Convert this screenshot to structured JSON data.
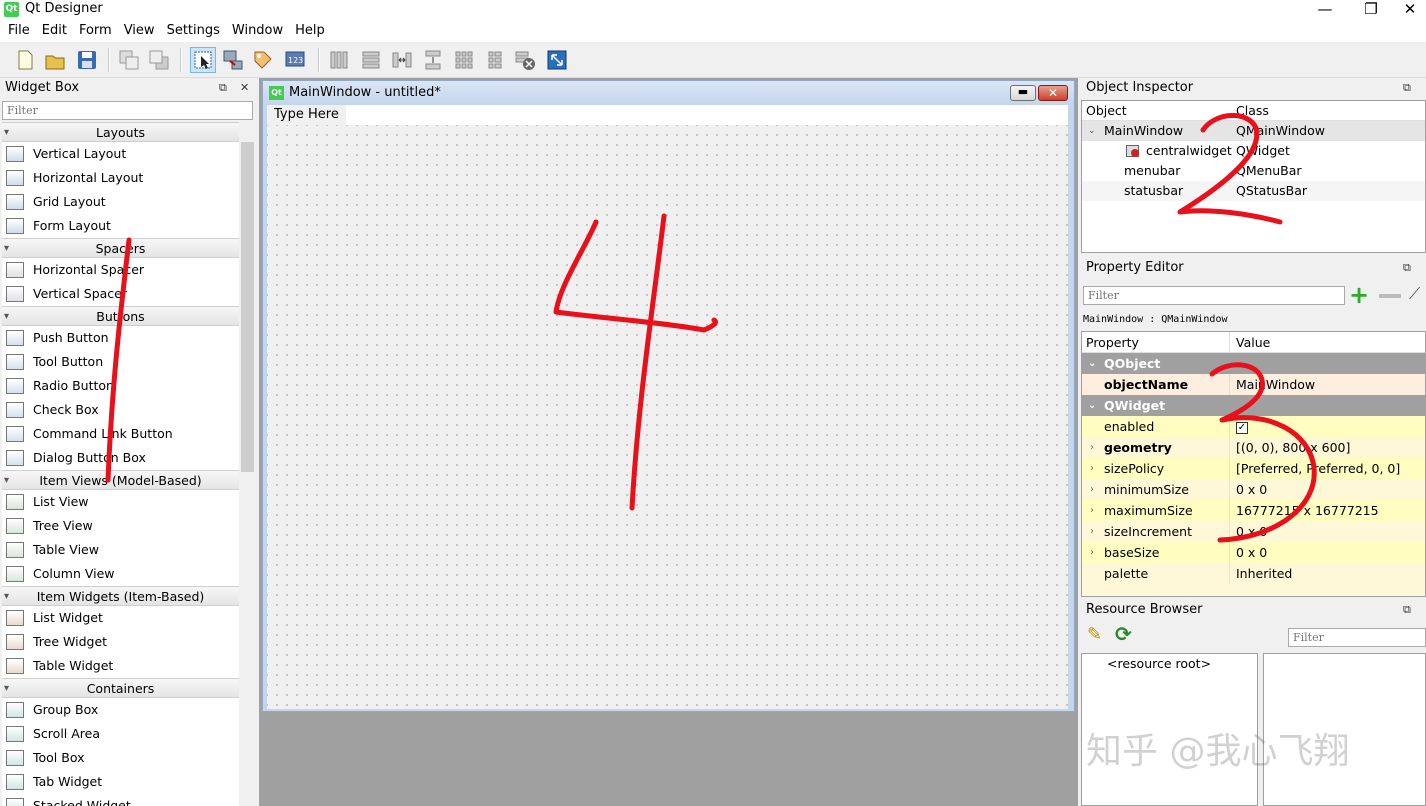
{
  "app": {
    "title": "Qt Designer",
    "icon": "qt-logo-icon"
  },
  "menu": [
    "File",
    "Edit",
    "Form",
    "View",
    "Settings",
    "Window",
    "Help"
  ],
  "toolbar": {
    "icons": [
      "new-file-icon",
      "open-file-icon",
      "save-icon",
      "send-to-back-icon",
      "bring-to-front-icon",
      "edit-widgets-icon",
      "edit-signals-icon",
      "edit-buddies-icon",
      "edit-tab-order-icon",
      "layout-horizontal-icon",
      "layout-vertical-icon",
      "layout-h-splitter-icon",
      "layout-v-splitter-icon",
      "layout-grid-icon",
      "layout-form-icon",
      "break-layout-icon",
      "adjust-size-icon"
    ]
  },
  "widget_box": {
    "title": "Widget Box",
    "filter_placeholder": "Filter",
    "categories": [
      {
        "name": "Layouts",
        "items": [
          "Vertical Layout",
          "Horizontal Layout",
          "Grid Layout",
          "Form Layout"
        ]
      },
      {
        "name": "Spacers",
        "items": [
          "Horizontal Spacer",
          "Vertical Spacer"
        ]
      },
      {
        "name": "Buttons",
        "items": [
          "Push Button",
          "Tool Button",
          "Radio Button",
          "Check Box",
          "Command Link Button",
          "Dialog Button Box"
        ]
      },
      {
        "name": "Item Views (Model-Based)",
        "items": [
          "List View",
          "Tree View",
          "Table View",
          "Column View"
        ]
      },
      {
        "name": "Item Widgets (Item-Based)",
        "items": [
          "List Widget",
          "Tree Widget",
          "Table Widget"
        ]
      },
      {
        "name": "Containers",
        "items": [
          "Group Box",
          "Scroll Area",
          "Tool Box",
          "Tab Widget",
          "Stacked Widget"
        ]
      }
    ]
  },
  "form": {
    "title": "MainWindow - untitled*",
    "menu_placeholder": "Type Here"
  },
  "object_inspector": {
    "title": "Object Inspector",
    "columns": [
      "Object",
      "Class"
    ],
    "rows": [
      {
        "object": "MainWindow",
        "class": "QMainWindow"
      },
      {
        "object": "centralwidget",
        "class": "QWidget"
      },
      {
        "object": "menubar",
        "class": "QMenuBar"
      },
      {
        "object": "statusbar",
        "class": "QStatusBar"
      }
    ]
  },
  "property_editor": {
    "title": "Property Editor",
    "filter_placeholder": "Filter",
    "context": "MainWindow : QMainWindow",
    "columns": [
      "Property",
      "Value"
    ],
    "rows": [
      {
        "kind": "group",
        "name": "QObject",
        "value": ""
      },
      {
        "kind": "prop",
        "name": "objectName",
        "value": "MainWindow",
        "bold": true
      },
      {
        "kind": "group",
        "name": "QWidget",
        "value": ""
      },
      {
        "kind": "prop",
        "name": "enabled",
        "value": "✓"
      },
      {
        "kind": "prop",
        "name": "geometry",
        "value": "[(0, 0), 800 x 600]",
        "bold": true
      },
      {
        "kind": "prop",
        "name": "sizePolicy",
        "value": "[Preferred, Preferred, 0, 0]"
      },
      {
        "kind": "prop",
        "name": "minimumSize",
        "value": "0 x 0"
      },
      {
        "kind": "prop",
        "name": "maximumSize",
        "value": "16777215 x 16777215"
      },
      {
        "kind": "prop",
        "name": "sizeIncrement",
        "value": "0 x 0"
      },
      {
        "kind": "prop",
        "name": "baseSize",
        "value": "0 x 0"
      },
      {
        "kind": "prop",
        "name": "palette",
        "value": "Inherited"
      }
    ]
  },
  "resource_browser": {
    "title": "Resource Browser",
    "filter_placeholder": "Filter",
    "root": "<resource root>"
  },
  "annotations": [
    "1",
    "2",
    "3",
    "4"
  ],
  "watermark": "知乎 @我心飞翔",
  "colors": {
    "annotation": "#e8101a",
    "selected_tool": "#cce4f7",
    "group_header": "#a0a0a0",
    "property_row": "#fffec0"
  }
}
